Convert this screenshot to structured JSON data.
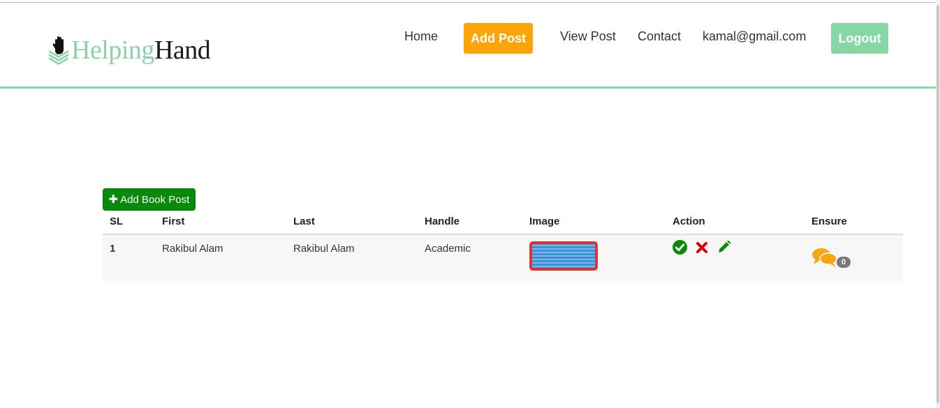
{
  "brand": {
    "word1": "Helping",
    "word2": "Hand"
  },
  "nav": {
    "home": "Home",
    "add_post": "Add Post",
    "view_post": "View Post",
    "contact": "Contact",
    "user_email": "kamal@gmail.com",
    "logout": "Logout"
  },
  "colors": {
    "accent_green": "#86d7a6",
    "orange": "#fca408",
    "dark_green": "#0a8a0a"
  },
  "toolbar": {
    "add_book_post": "Add Book Post"
  },
  "table": {
    "headers": [
      "SL",
      "First",
      "Last",
      "Handle",
      "Image",
      "Action",
      "Ensure"
    ],
    "rows": [
      {
        "sl": "1",
        "first": "Rakibul Alam",
        "last": "Rakibul Alam",
        "handle": "Academic",
        "ensure_count": "0"
      }
    ]
  },
  "icons": {
    "logo": "raised-hand-icon",
    "approve": "check-circle-icon",
    "delete": "x-icon",
    "edit": "pencil-icon",
    "comments": "comments-icon",
    "add": "plus-icon"
  }
}
